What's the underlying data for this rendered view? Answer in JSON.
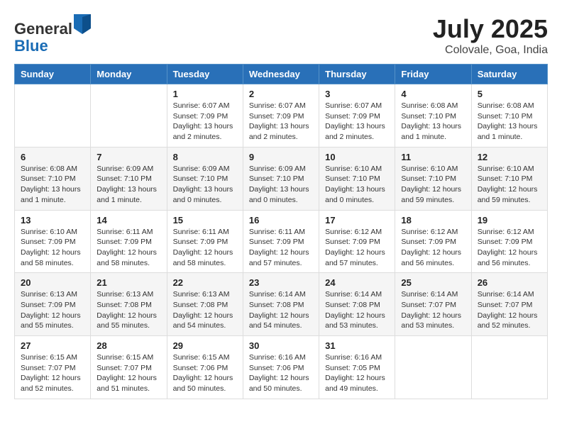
{
  "logo": {
    "general": "General",
    "blue": "Blue"
  },
  "header": {
    "month": "July 2025",
    "location": "Colovale, Goa, India"
  },
  "weekdays": [
    "Sunday",
    "Monday",
    "Tuesday",
    "Wednesday",
    "Thursday",
    "Friday",
    "Saturday"
  ],
  "weeks": [
    [
      {
        "day": "",
        "info": ""
      },
      {
        "day": "",
        "info": ""
      },
      {
        "day": "1",
        "info": "Sunrise: 6:07 AM\nSunset: 7:09 PM\nDaylight: 13 hours\nand 2 minutes."
      },
      {
        "day": "2",
        "info": "Sunrise: 6:07 AM\nSunset: 7:09 PM\nDaylight: 13 hours\nand 2 minutes."
      },
      {
        "day": "3",
        "info": "Sunrise: 6:07 AM\nSunset: 7:09 PM\nDaylight: 13 hours\nand 2 minutes."
      },
      {
        "day": "4",
        "info": "Sunrise: 6:08 AM\nSunset: 7:10 PM\nDaylight: 13 hours\nand 1 minute."
      },
      {
        "day": "5",
        "info": "Sunrise: 6:08 AM\nSunset: 7:10 PM\nDaylight: 13 hours\nand 1 minute."
      }
    ],
    [
      {
        "day": "6",
        "info": "Sunrise: 6:08 AM\nSunset: 7:10 PM\nDaylight: 13 hours\nand 1 minute."
      },
      {
        "day": "7",
        "info": "Sunrise: 6:09 AM\nSunset: 7:10 PM\nDaylight: 13 hours\nand 1 minute."
      },
      {
        "day": "8",
        "info": "Sunrise: 6:09 AM\nSunset: 7:10 PM\nDaylight: 13 hours\nand 0 minutes."
      },
      {
        "day": "9",
        "info": "Sunrise: 6:09 AM\nSunset: 7:10 PM\nDaylight: 13 hours\nand 0 minutes."
      },
      {
        "day": "10",
        "info": "Sunrise: 6:10 AM\nSunset: 7:10 PM\nDaylight: 13 hours\nand 0 minutes."
      },
      {
        "day": "11",
        "info": "Sunrise: 6:10 AM\nSunset: 7:10 PM\nDaylight: 12 hours\nand 59 minutes."
      },
      {
        "day": "12",
        "info": "Sunrise: 6:10 AM\nSunset: 7:10 PM\nDaylight: 12 hours\nand 59 minutes."
      }
    ],
    [
      {
        "day": "13",
        "info": "Sunrise: 6:10 AM\nSunset: 7:09 PM\nDaylight: 12 hours\nand 58 minutes."
      },
      {
        "day": "14",
        "info": "Sunrise: 6:11 AM\nSunset: 7:09 PM\nDaylight: 12 hours\nand 58 minutes."
      },
      {
        "day": "15",
        "info": "Sunrise: 6:11 AM\nSunset: 7:09 PM\nDaylight: 12 hours\nand 58 minutes."
      },
      {
        "day": "16",
        "info": "Sunrise: 6:11 AM\nSunset: 7:09 PM\nDaylight: 12 hours\nand 57 minutes."
      },
      {
        "day": "17",
        "info": "Sunrise: 6:12 AM\nSunset: 7:09 PM\nDaylight: 12 hours\nand 57 minutes."
      },
      {
        "day": "18",
        "info": "Sunrise: 6:12 AM\nSunset: 7:09 PM\nDaylight: 12 hours\nand 56 minutes."
      },
      {
        "day": "19",
        "info": "Sunrise: 6:12 AM\nSunset: 7:09 PM\nDaylight: 12 hours\nand 56 minutes."
      }
    ],
    [
      {
        "day": "20",
        "info": "Sunrise: 6:13 AM\nSunset: 7:09 PM\nDaylight: 12 hours\nand 55 minutes."
      },
      {
        "day": "21",
        "info": "Sunrise: 6:13 AM\nSunset: 7:08 PM\nDaylight: 12 hours\nand 55 minutes."
      },
      {
        "day": "22",
        "info": "Sunrise: 6:13 AM\nSunset: 7:08 PM\nDaylight: 12 hours\nand 54 minutes."
      },
      {
        "day": "23",
        "info": "Sunrise: 6:14 AM\nSunset: 7:08 PM\nDaylight: 12 hours\nand 54 minutes."
      },
      {
        "day": "24",
        "info": "Sunrise: 6:14 AM\nSunset: 7:08 PM\nDaylight: 12 hours\nand 53 minutes."
      },
      {
        "day": "25",
        "info": "Sunrise: 6:14 AM\nSunset: 7:07 PM\nDaylight: 12 hours\nand 53 minutes."
      },
      {
        "day": "26",
        "info": "Sunrise: 6:14 AM\nSunset: 7:07 PM\nDaylight: 12 hours\nand 52 minutes."
      }
    ],
    [
      {
        "day": "27",
        "info": "Sunrise: 6:15 AM\nSunset: 7:07 PM\nDaylight: 12 hours\nand 52 minutes."
      },
      {
        "day": "28",
        "info": "Sunrise: 6:15 AM\nSunset: 7:07 PM\nDaylight: 12 hours\nand 51 minutes."
      },
      {
        "day": "29",
        "info": "Sunrise: 6:15 AM\nSunset: 7:06 PM\nDaylight: 12 hours\nand 50 minutes."
      },
      {
        "day": "30",
        "info": "Sunrise: 6:16 AM\nSunset: 7:06 PM\nDaylight: 12 hours\nand 50 minutes."
      },
      {
        "day": "31",
        "info": "Sunrise: 6:16 AM\nSunset: 7:05 PM\nDaylight: 12 hours\nand 49 minutes."
      },
      {
        "day": "",
        "info": ""
      },
      {
        "day": "",
        "info": ""
      }
    ]
  ]
}
